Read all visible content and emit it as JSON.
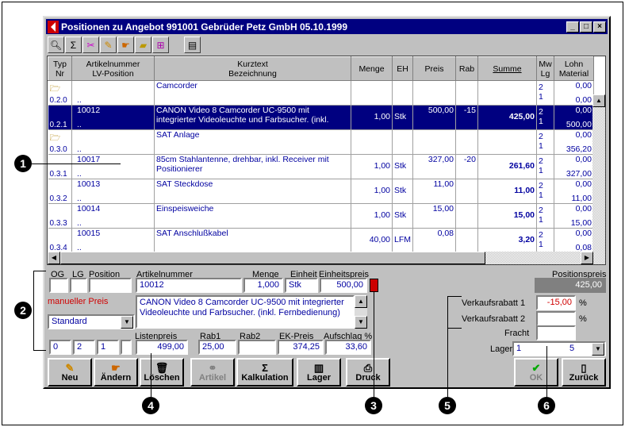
{
  "window": {
    "title": "Positionen zu Angebot 991001 Gebrüder Petz GmbH 05.10.1999"
  },
  "toolbar": {
    "icons": [
      "search-icon",
      "sigma-icon",
      "scissors-icon",
      "pencil-icon",
      "hand-icon",
      "folder-icon",
      "tree-icon",
      "document-icon"
    ]
  },
  "grid": {
    "headers": [
      {
        "l1": "Typ",
        "l2": "Nr"
      },
      {
        "l1": "Artikelnummer",
        "l2": "LV-Position"
      },
      {
        "l1": "Kurztext",
        "l2": "Bezeichnung"
      },
      {
        "l1": "Menge",
        "l2": ""
      },
      {
        "l1": "EH",
        "l2": ""
      },
      {
        "l1": "Preis",
        "l2": ""
      },
      {
        "l1": "Rab",
        "l2": ""
      },
      {
        "l1": "Summe",
        "l2": ""
      },
      {
        "l1": "Mw",
        "l2": "Lg"
      },
      {
        "l1": "Lohn",
        "l2": "Material"
      }
    ],
    "rows": [
      {
        "folder": true,
        "typ": "0.2.0",
        "art": "",
        "lv": "..",
        "text": "Camcorder",
        "text2": "",
        "menge": "",
        "eh": "",
        "preis": "",
        "rab": "",
        "summe": "",
        "mw": "2",
        "lg": "1",
        "lohn": "0,00",
        "mat": "0,00",
        "selected": false
      },
      {
        "folder": false,
        "typ": "0.2.1",
        "art": "10012",
        "lv": "..",
        "text": "CANON Video 8 Camcorder UC-9500 mit",
        "text2": "integrierter Videoleuchte und Farbsucher. (inkl.",
        "menge": "1,00",
        "eh": "Stk",
        "preis": "500,00",
        "rab": "-15",
        "summe": "425,00",
        "mw": "2",
        "lg": "1",
        "lohn": "0,00",
        "mat": "500,00",
        "selected": true
      },
      {
        "folder": true,
        "typ": "0.3.0",
        "art": "",
        "lv": "..",
        "text": "SAT Anlage",
        "text2": "",
        "menge": "",
        "eh": "",
        "preis": "",
        "rab": "",
        "summe": "",
        "mw": "2",
        "lg": "1",
        "lohn": "0,00",
        "mat": "356,20",
        "selected": false
      },
      {
        "folder": false,
        "typ": "0.3.1",
        "art": "10017",
        "lv": "..",
        "text": "85cm Stahlantenne, drehbar, inkl. Receiver mit",
        "text2": "Positionierer",
        "menge": "1,00",
        "eh": "Stk",
        "preis": "327,00",
        "rab": "-20",
        "summe": "261,60",
        "mw": "2",
        "lg": "1",
        "lohn": "0,00",
        "mat": "327,00",
        "selected": false
      },
      {
        "folder": false,
        "typ": "0.3.2",
        "art": "10013",
        "lv": "..",
        "text": "SAT Steckdose",
        "text2": "",
        "menge": "1,00",
        "eh": "Stk",
        "preis": "11,00",
        "rab": "",
        "summe": "11,00",
        "mw": "2",
        "lg": "1",
        "lohn": "0,00",
        "mat": "11,00",
        "selected": false
      },
      {
        "folder": false,
        "typ": "0.3.3",
        "art": "10014",
        "lv": "..",
        "text": "Einspeisweiche",
        "text2": "",
        "menge": "1,00",
        "eh": "Stk",
        "preis": "15,00",
        "rab": "",
        "summe": "15,00",
        "mw": "2",
        "lg": "1",
        "lohn": "0,00",
        "mat": "15,00",
        "selected": false
      },
      {
        "folder": false,
        "typ": "0.3.4",
        "art": "10015",
        "lv": "..",
        "text": "SAT Anschlußkabel",
        "text2": "",
        "menge": "40,00",
        "eh": "LFM",
        "preis": "0,08",
        "rab": "",
        "summe": "3,20",
        "mw": "2",
        "lg": "1",
        "lohn": "0,00",
        "mat": "0,08",
        "selected": false
      }
    ]
  },
  "form": {
    "og_label": "OG",
    "lg_label": "LG",
    "position_label": "Position",
    "artikelnummer_label": "Artikelnummer",
    "artikelnummer": "10012",
    "menge_label": "Menge",
    "menge": "1,000",
    "einheit_label": "Einheit",
    "einheit": "Stk",
    "einheitspreis_label": "Einheitspreis",
    "einheitspreis": "500,00",
    "manueller_preis": "manueller Preis",
    "beschreibung_l1": "CANON Video 8 Camcorder UC-9500 mit integrierter",
    "beschreibung_l2": "Videoleuchte und Farbsucher. (inkl. Fernbedienung)",
    "preisart": "Standard",
    "og_val": "0",
    "lg_val": "2",
    "pos_val": "1",
    "listenpreis_label": "Listenpreis",
    "listenpreis": "499,00",
    "rab1_label": "Rab1",
    "rab1": "25,00",
    "rab2_label": "Rab2",
    "rab2": "",
    "ekpreis_label": "EK-Preis",
    "ekpreis": "374,25",
    "aufschlag_label": "Aufschlag %",
    "aufschlag": "33,60",
    "positionspreis_label": "Positionspreis",
    "positionspreis": "425,00",
    "vk1_label": "Verkaufsrabatt 1",
    "vk1": "-15,00",
    "vk2_label": "Verkaufsrabatt 2",
    "vk2": "",
    "fracht_label": "Fracht",
    "fracht": "",
    "pct": "%",
    "lager_label": "Lager",
    "lager_val1": "1",
    "lager_val2": "5"
  },
  "buttons": {
    "neu": "Neu",
    "aendern": "Ändern",
    "loeschen": "Löschen",
    "artikel": "Artikel",
    "kalkulation": "Kalkulation",
    "lager": "Lager",
    "druck": "Druck",
    "ok": "OK",
    "zurueck": "Zurück"
  },
  "callouts": [
    "1",
    "2",
    "3",
    "4",
    "5",
    "6"
  ],
  "colors": {
    "title_bg": "#000080",
    "selection": "#000080",
    "value_text": "#0000a0",
    "manual_price": "#d00000",
    "positionspreis_bg": "#808080"
  }
}
